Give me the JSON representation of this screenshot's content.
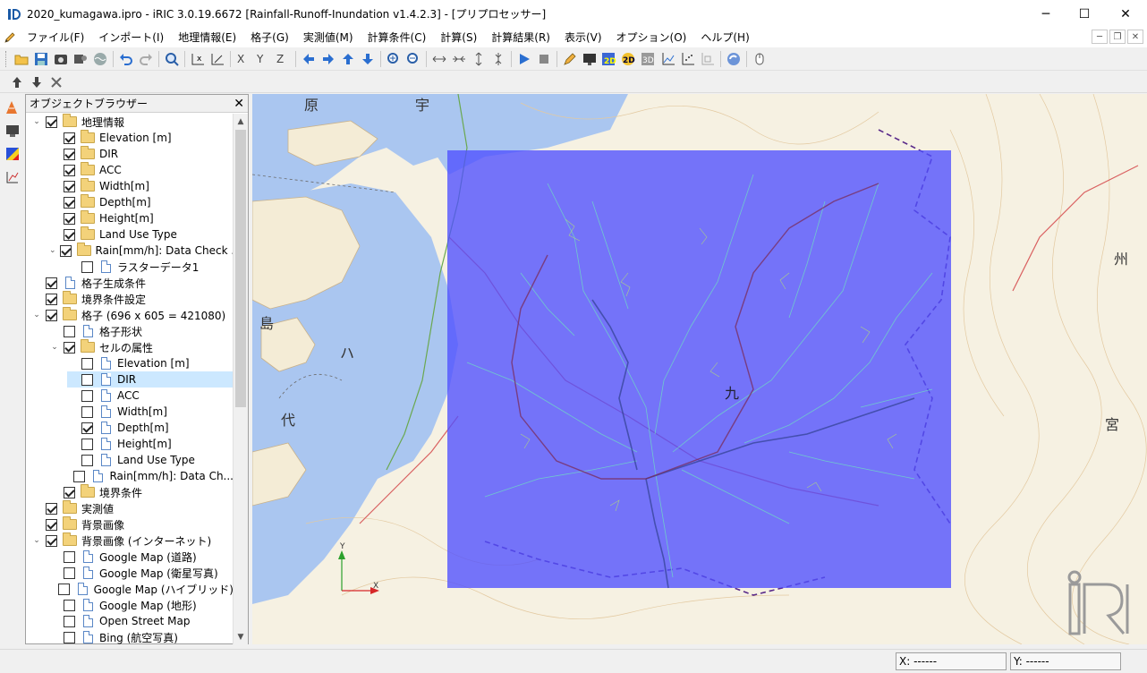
{
  "window": {
    "title": "2020_kumagawa.ipro - iRIC 3.0.19.6672 [Rainfall-Runoff-Inundation v1.4.2.3] - [プリプロセッサー]",
    "minimize": "─",
    "maximize": "☐",
    "close": "✕"
  },
  "menu": {
    "items": [
      "ファイル(F)",
      "インポート(I)",
      "地理情報(E)",
      "格子(G)",
      "実測値(M)",
      "計算条件(C)",
      "計算(S)",
      "計算結果(R)",
      "表示(V)",
      "オプション(O)",
      "ヘルプ(H)"
    ]
  },
  "mdi": {
    "minimize": "─",
    "restore": "❐",
    "close": "✕"
  },
  "browser": {
    "title": "オブジェクトブラウザー",
    "close": "✕",
    "tree": [
      {
        "level": 0,
        "expand": "⌄",
        "checked": true,
        "icon": "folder",
        "label": "地理情報"
      },
      {
        "level": 1,
        "expand": "",
        "checked": true,
        "icon": "folder",
        "label": "Elevation [m]"
      },
      {
        "level": 1,
        "expand": "",
        "checked": true,
        "icon": "folder",
        "label": "DIR"
      },
      {
        "level": 1,
        "expand": "",
        "checked": true,
        "icon": "folder",
        "label": "ACC"
      },
      {
        "level": 1,
        "expand": "",
        "checked": true,
        "icon": "folder",
        "label": "Width[m]"
      },
      {
        "level": 1,
        "expand": "",
        "checked": true,
        "icon": "folder",
        "label": "Depth[m]"
      },
      {
        "level": 1,
        "expand": "",
        "checked": true,
        "icon": "folder",
        "label": "Height[m]"
      },
      {
        "level": 1,
        "expand": "",
        "checked": true,
        "icon": "folder",
        "label": "Land Use Type"
      },
      {
        "level": 1,
        "expand": "⌄",
        "checked": true,
        "icon": "folder",
        "label": "Rain[mm/h]: Data Check ..."
      },
      {
        "level": 2,
        "expand": "",
        "checked": false,
        "icon": "doc",
        "label": "ラスターデータ1"
      },
      {
        "level": 0,
        "expand": "",
        "checked": true,
        "icon": "doc",
        "label": "格子生成条件"
      },
      {
        "level": 0,
        "expand": "",
        "checked": true,
        "icon": "folder",
        "label": "境界条件設定"
      },
      {
        "level": 0,
        "expand": "⌄",
        "checked": true,
        "icon": "folder",
        "label": "格子 (696 x 605 = 421080)"
      },
      {
        "level": 1,
        "expand": "",
        "checked": false,
        "icon": "doc",
        "label": "格子形状"
      },
      {
        "level": 1,
        "expand": "⌄",
        "checked": true,
        "icon": "folder",
        "label": "セルの属性"
      },
      {
        "level": 2,
        "expand": "",
        "checked": false,
        "icon": "doc",
        "label": "Elevation [m]"
      },
      {
        "level": 2,
        "expand": "",
        "checked": false,
        "icon": "doc",
        "label": "DIR",
        "selected": true
      },
      {
        "level": 2,
        "expand": "",
        "checked": false,
        "icon": "doc",
        "label": "ACC"
      },
      {
        "level": 2,
        "expand": "",
        "checked": false,
        "icon": "doc",
        "label": "Width[m]"
      },
      {
        "level": 2,
        "expand": "",
        "checked": true,
        "icon": "doc",
        "label": "Depth[m]"
      },
      {
        "level": 2,
        "expand": "",
        "checked": false,
        "icon": "doc",
        "label": "Height[m]"
      },
      {
        "level": 2,
        "expand": "",
        "checked": false,
        "icon": "doc",
        "label": "Land Use Type"
      },
      {
        "level": 2,
        "expand": "",
        "checked": false,
        "icon": "doc",
        "label": "Rain[mm/h]: Data Ch..."
      },
      {
        "level": 1,
        "expand": "",
        "checked": true,
        "icon": "folder",
        "label": "境界条件"
      },
      {
        "level": 0,
        "expand": "",
        "checked": true,
        "icon": "folder",
        "label": "実測値"
      },
      {
        "level": 0,
        "expand": "",
        "checked": true,
        "icon": "folder",
        "label": "背景画像"
      },
      {
        "level": 0,
        "expand": "⌄",
        "checked": true,
        "icon": "folder",
        "label": "背景画像 (インターネット)"
      },
      {
        "level": 1,
        "expand": "",
        "checked": false,
        "icon": "doc",
        "label": "Google Map (道路)"
      },
      {
        "level": 1,
        "expand": "",
        "checked": false,
        "icon": "doc",
        "label": "Google Map (衛星写真)"
      },
      {
        "level": 1,
        "expand": "",
        "checked": false,
        "icon": "doc",
        "label": "Google Map (ハイブリッド)"
      },
      {
        "level": 1,
        "expand": "",
        "checked": false,
        "icon": "doc",
        "label": "Google Map (地形)"
      },
      {
        "level": 1,
        "expand": "",
        "checked": false,
        "icon": "doc",
        "label": "Open Street Map"
      },
      {
        "level": 1,
        "expand": "",
        "checked": false,
        "icon": "doc",
        "label": "Bing (航空写真)"
      }
    ]
  },
  "map": {
    "labels": {
      "hara": "原",
      "u": "宇",
      "shima": "島",
      "ha": "ハ",
      "dai": "代",
      "kyu": "九",
      "miya": "宮",
      "shu": "州"
    },
    "grid_color": "#5050ff",
    "sea_color": "#aac6f0",
    "land_color": "#f6f1e2",
    "logo": "iRIC",
    "axis_x": "X",
    "axis_y": "Y"
  },
  "status": {
    "x": "X: ------",
    "y": "Y: ------"
  }
}
